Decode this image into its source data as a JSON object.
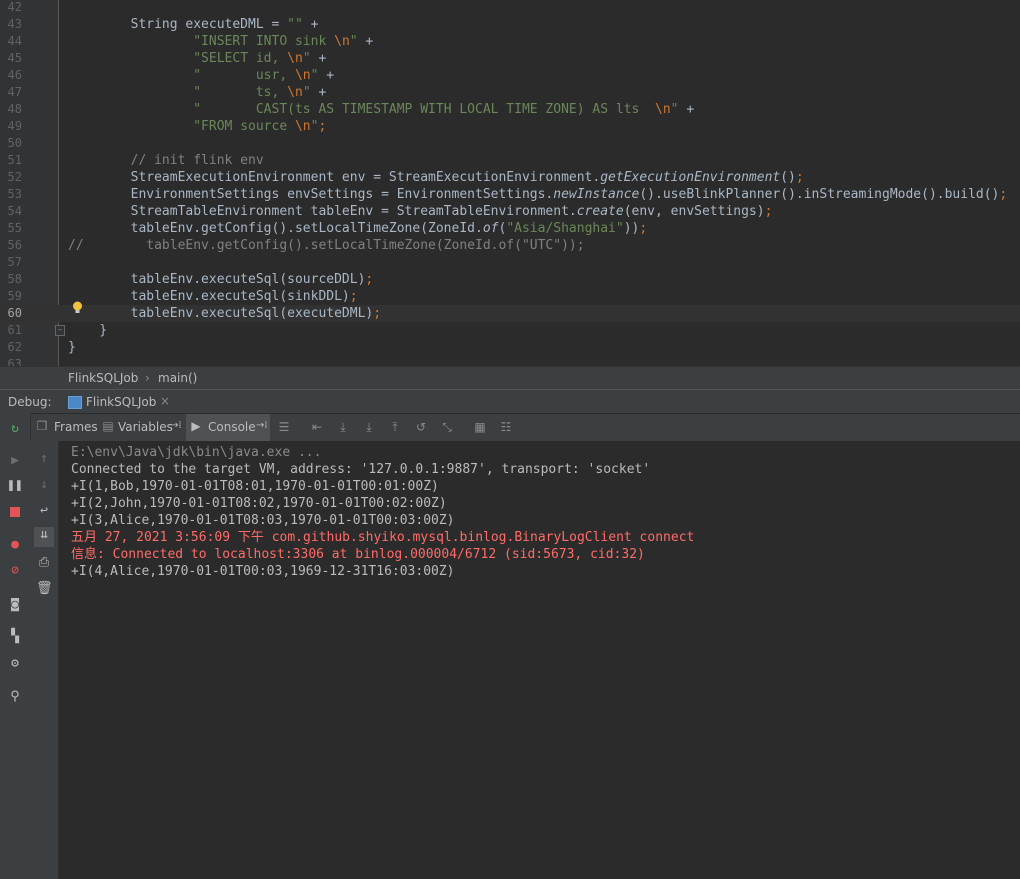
{
  "editor": {
    "lines": [
      {
        "num": "42",
        "segs": []
      },
      {
        "num": "43",
        "segs": [
          {
            "t": "        String executeDML = ",
            "c": ""
          },
          {
            "t": "\"\"",
            "c": "s"
          },
          {
            "t": " +",
            "c": ""
          }
        ]
      },
      {
        "num": "44",
        "segs": [
          {
            "t": "                ",
            "c": ""
          },
          {
            "t": "\"INSERT INTO sink ",
            "c": "s"
          },
          {
            "t": "\\n",
            "c": "k"
          },
          {
            "t": "\"",
            "c": "s"
          },
          {
            "t": " +",
            "c": ""
          }
        ]
      },
      {
        "num": "45",
        "segs": [
          {
            "t": "                ",
            "c": ""
          },
          {
            "t": "\"SELECT id, ",
            "c": "s"
          },
          {
            "t": "\\n",
            "c": "k"
          },
          {
            "t": "\"",
            "c": "s"
          },
          {
            "t": " +",
            "c": ""
          }
        ]
      },
      {
        "num": "46",
        "segs": [
          {
            "t": "                ",
            "c": ""
          },
          {
            "t": "\"       usr, ",
            "c": "s"
          },
          {
            "t": "\\n",
            "c": "k"
          },
          {
            "t": "\"",
            "c": "s"
          },
          {
            "t": " +",
            "c": ""
          }
        ]
      },
      {
        "num": "47",
        "segs": [
          {
            "t": "                ",
            "c": ""
          },
          {
            "t": "\"       ts, ",
            "c": "s"
          },
          {
            "t": "\\n",
            "c": "k"
          },
          {
            "t": "\"",
            "c": "s"
          },
          {
            "t": " +",
            "c": ""
          }
        ]
      },
      {
        "num": "48",
        "segs": [
          {
            "t": "                ",
            "c": ""
          },
          {
            "t": "\"       CAST(ts AS TIMESTAMP WITH LOCAL TIME ZONE) AS lts  ",
            "c": "s"
          },
          {
            "t": "\\n",
            "c": "k"
          },
          {
            "t": "\"",
            "c": "s"
          },
          {
            "t": " +",
            "c": ""
          }
        ]
      },
      {
        "num": "49",
        "segs": [
          {
            "t": "                ",
            "c": ""
          },
          {
            "t": "\"FROM source ",
            "c": "s"
          },
          {
            "t": "\\n",
            "c": "k"
          },
          {
            "t": "\"",
            "c": "s"
          },
          {
            "t": ";",
            "c": "k"
          }
        ]
      },
      {
        "num": "50",
        "segs": []
      },
      {
        "num": "51",
        "segs": [
          {
            "t": "        // init flink env",
            "c": "c"
          }
        ]
      },
      {
        "num": "52",
        "segs": [
          {
            "t": "        StreamExecutionEnvironment env = StreamExecutionEnvironment.",
            "c": ""
          },
          {
            "t": "getExecutionEnvironment",
            "c": "it"
          },
          {
            "t": "()",
            "c": ""
          },
          {
            "t": ";",
            "c": "k"
          }
        ]
      },
      {
        "num": "53",
        "segs": [
          {
            "t": "        EnvironmentSettings envSettings = EnvironmentSettings.",
            "c": ""
          },
          {
            "t": "newInstance",
            "c": "it"
          },
          {
            "t": "().useBlinkPlanner().inStreamingMode().build()",
            "c": ""
          },
          {
            "t": ";",
            "c": "k"
          }
        ]
      },
      {
        "num": "54",
        "segs": [
          {
            "t": "        StreamTableEnvironment tableEnv = StreamTableEnvironment.",
            "c": ""
          },
          {
            "t": "create",
            "c": "it"
          },
          {
            "t": "(env, envSettings)",
            "c": ""
          },
          {
            "t": ";",
            "c": "k"
          }
        ]
      },
      {
        "num": "55",
        "segs": [
          {
            "t": "        tableEnv.getConfig().setLocalTimeZone(ZoneId.",
            "c": ""
          },
          {
            "t": "of",
            "c": "it"
          },
          {
            "t": "(",
            "c": ""
          },
          {
            "t": "\"Asia/Shanghai\"",
            "c": "s"
          },
          {
            "t": "))",
            "c": ""
          },
          {
            "t": ";",
            "c": "k"
          }
        ]
      },
      {
        "num": "56",
        "segs": [
          {
            "t": "//        tableEnv.getConfig().setLocalTimeZone(ZoneId.of(\"UTC\"));",
            "c": "c"
          }
        ]
      },
      {
        "num": "57",
        "segs": []
      },
      {
        "num": "58",
        "segs": [
          {
            "t": "        tableEnv.executeSql(sourceDDL)",
            "c": ""
          },
          {
            "t": ";",
            "c": "k"
          }
        ]
      },
      {
        "num": "59",
        "segs": [
          {
            "t": "        tableEnv.executeSql(sinkDDL)",
            "c": ""
          },
          {
            "t": ";",
            "c": "k"
          }
        ]
      },
      {
        "num": "60",
        "segs": [
          {
            "t": "        tableEnv.executeSql(executeDML)",
            "c": ""
          },
          {
            "t": ";",
            "c": "k"
          }
        ],
        "current": true
      },
      {
        "num": "61",
        "segs": [
          {
            "t": "    }",
            "c": ""
          }
        ]
      },
      {
        "num": "62",
        "segs": [
          {
            "t": "}",
            "c": ""
          }
        ]
      },
      {
        "num": "63",
        "segs": []
      }
    ]
  },
  "breadcrumb": {
    "class_name": "FlinkSQLJob",
    "separator": "›",
    "method": "main()"
  },
  "debug": {
    "label": "Debug:",
    "session_tab": "FlinkSQLJob",
    "close": "×"
  },
  "toolbar": {
    "frames": "Frames",
    "variables": "Variables",
    "console": "Console",
    "pin": "→⁞"
  },
  "console": {
    "lines": [
      {
        "text": "E:\\env\\Java\\jdk\\bin\\java.exe ...",
        "style": "gray"
      },
      {
        "text": "Connected to the target VM, address: '127.0.0.1:9887', transport: 'socket'",
        "style": ""
      },
      {
        "text": "+I(1,Bob,1970-01-01T08:01,1970-01-01T00:01:00Z)",
        "style": ""
      },
      {
        "text": "+I(2,John,1970-01-01T08:02,1970-01-01T00:02:00Z)",
        "style": ""
      },
      {
        "text": "+I(3,Alice,1970-01-01T08:03,1970-01-01T00:03:00Z)",
        "style": ""
      },
      {
        "text": "五月 27, 2021 3:56:09 下午 com.github.shyiko.mysql.binlog.BinaryLogClient connect",
        "style": "red"
      },
      {
        "text": "信息: Connected to localhost:3306 at binlog.000004/6712 (sid:5673, cid:32)",
        "style": "red"
      },
      {
        "text": "+I(4,Alice,1970-01-01T00:03,1969-12-31T16:03:00Z)",
        "style": ""
      }
    ]
  },
  "colors": {
    "accent_green": "#59a869",
    "stop_red": "#e05555",
    "string_green": "#6a8759",
    "keyword_orange": "#cc7832",
    "error_red": "#ff6b68"
  },
  "icons": {
    "left": [
      "rerun-icon",
      "resume-icon",
      "pause-icon",
      "stop-icon",
      "view-breakpoints-icon",
      "mute-breakpoints-icon",
      "camera-icon",
      "layout-icon",
      "settings-icon",
      "pin-icon"
    ],
    "mid": [
      "up-arrow-icon",
      "down-arrow-icon",
      "soft-wrap-icon",
      "scroll-to-end-icon",
      "print-icon",
      "clear-all-icon"
    ]
  }
}
